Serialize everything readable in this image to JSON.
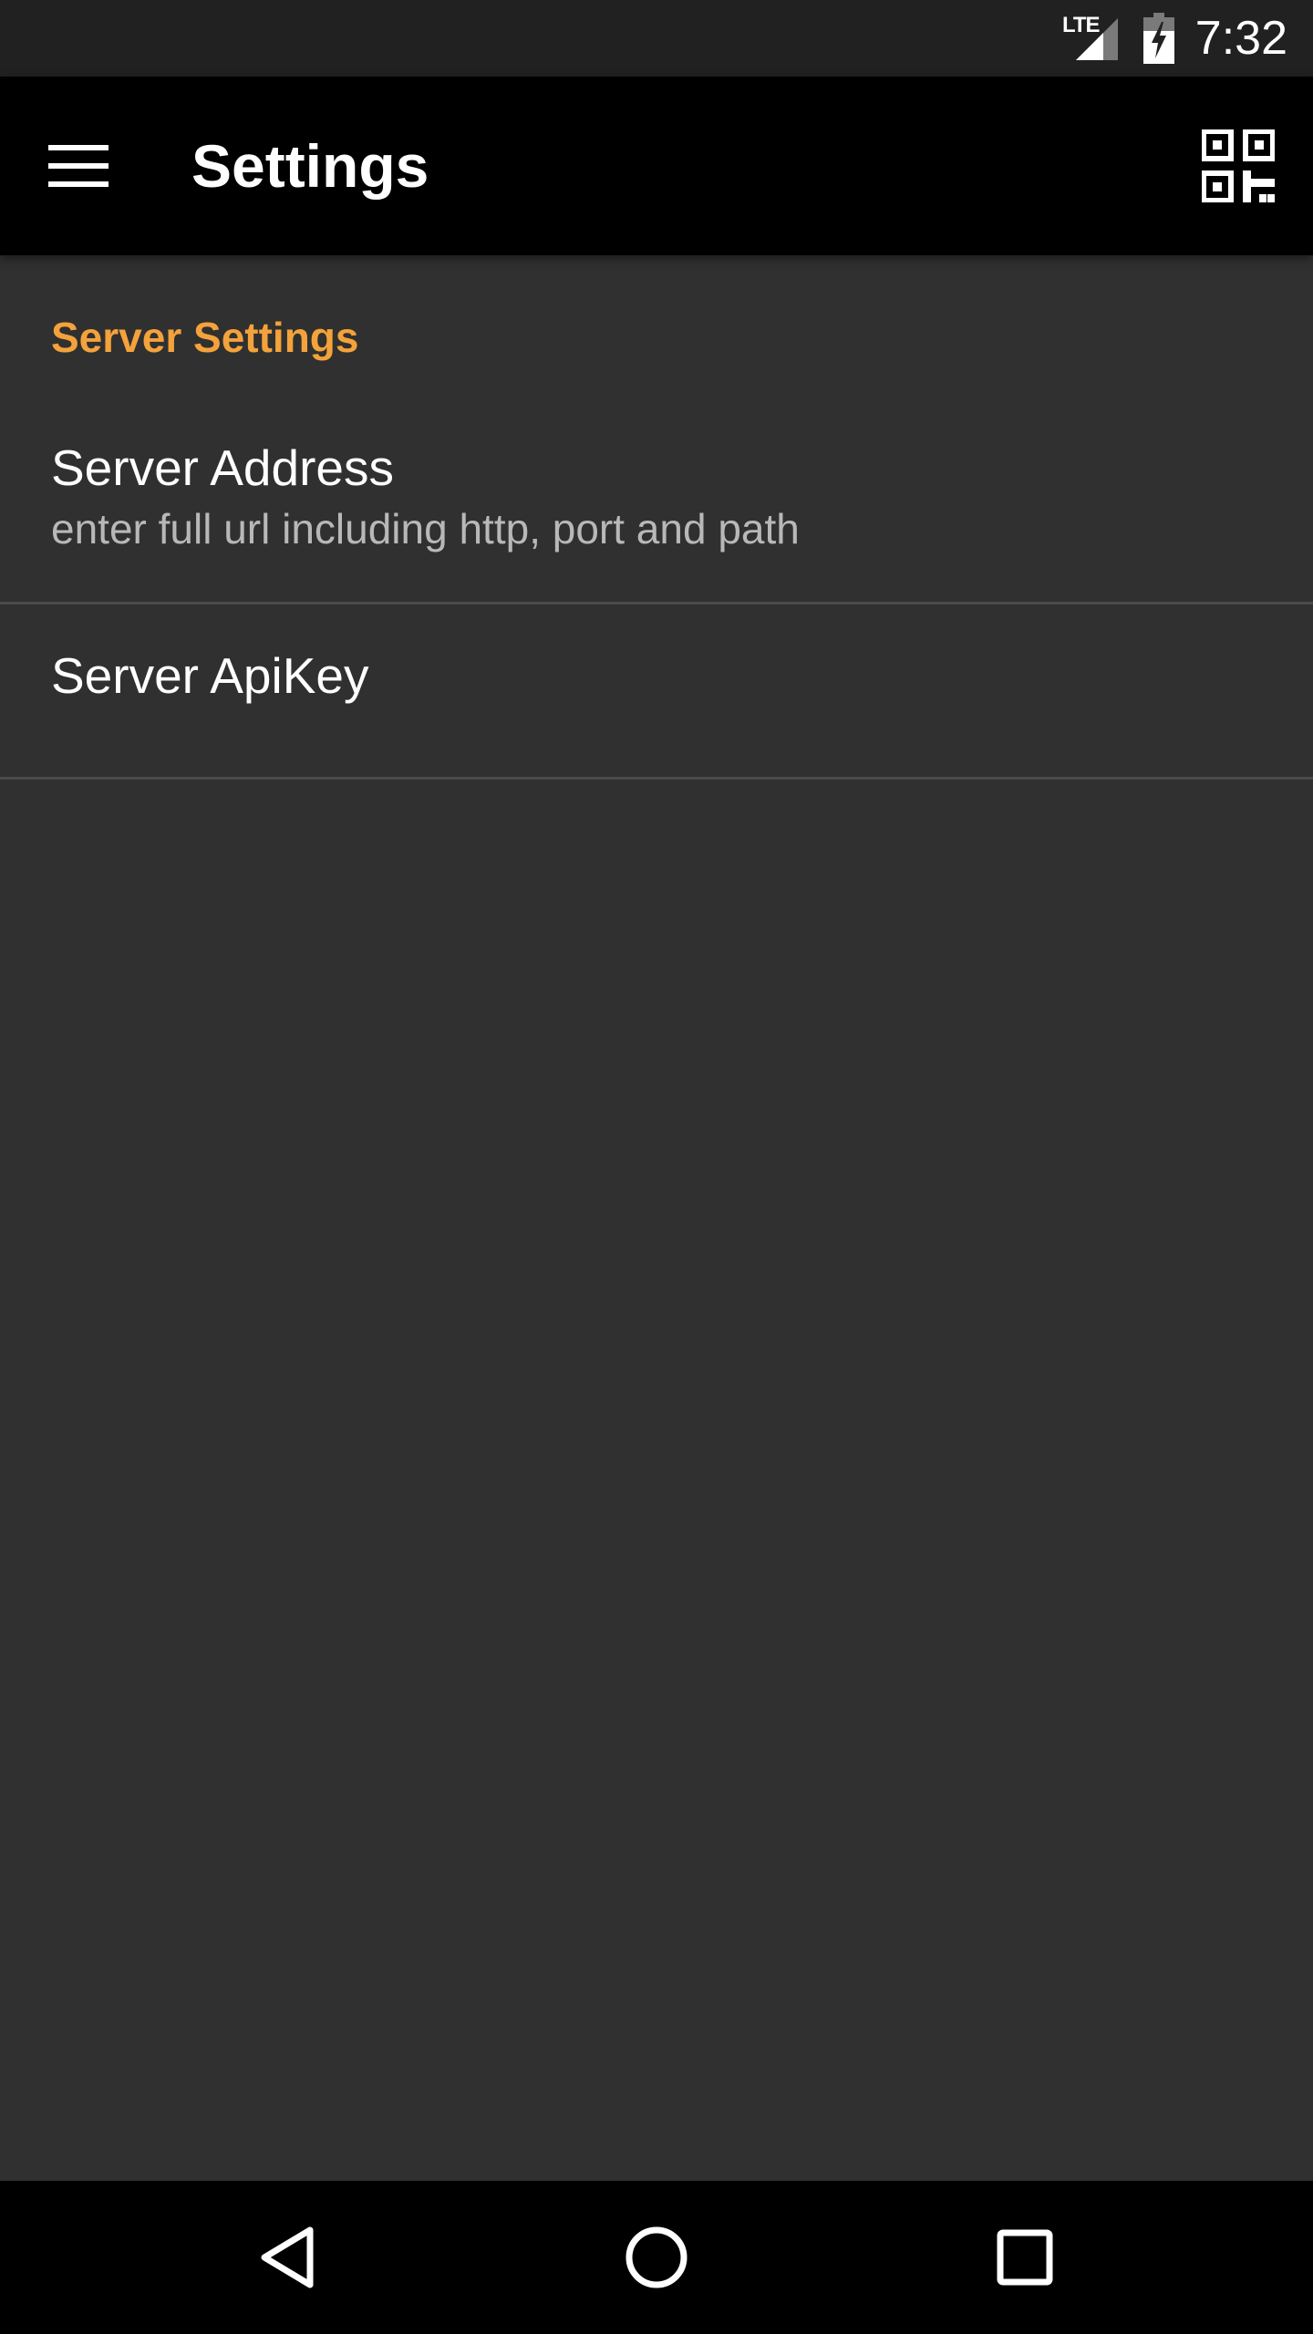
{
  "status_bar": {
    "network_label": "LTE",
    "time": "7:32"
  },
  "toolbar": {
    "title": "Settings",
    "menu_icon": "hamburger-menu-icon",
    "action_icon": "qr-code-icon"
  },
  "settings": {
    "category": "Server Settings",
    "items": [
      {
        "title": "Server Address",
        "summary": "enter full url including http, port and path"
      },
      {
        "title": "Server ApiKey",
        "summary": ""
      }
    ]
  },
  "nav_bar": {
    "back_icon": "back-triangle-icon",
    "home_icon": "home-circle-icon",
    "recents_icon": "recents-square-icon"
  },
  "colors": {
    "accent": "#f4a23b",
    "background": "#303030",
    "toolbar": "#000000",
    "status_bar": "#212121"
  }
}
